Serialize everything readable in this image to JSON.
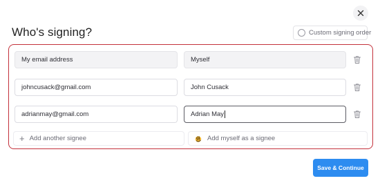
{
  "dialog": {
    "title": "Who's signing?",
    "custom_order_label": "Custom signing order"
  },
  "signers": [
    {
      "email": "My email address",
      "name": "Myself"
    },
    {
      "email": "johncusack@gmail.com",
      "name": "John Cusack"
    },
    {
      "email": "adrianmay@gmail.com",
      "name": "Adrian May"
    }
  ],
  "actions": {
    "add_signee": "Add another signee",
    "add_myself": "Add myself as a signee",
    "save": "Save & Continue"
  },
  "colors": {
    "accent": "#2d8cf0",
    "highlight_border": "#c3303a"
  }
}
